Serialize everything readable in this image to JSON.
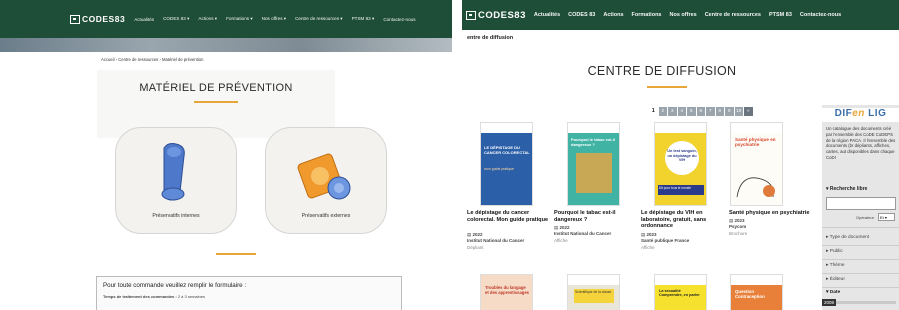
{
  "left": {
    "nav": {
      "logo": "CODES83",
      "items": [
        "Actualités",
        "CODES 83 ▾",
        "Actions ▾",
        "Formations ▾",
        "Nos offres ▾",
        "Centre de ressources ▾",
        "PTSM 83 ▾",
        "Contactez-nous"
      ]
    },
    "breadcrumb": "Accueil › Centre de ressources › Matériel de prévention",
    "title": "MATÉRIEL DE PRÉVENTION",
    "cards": [
      "Préservatifs internes",
      "Préservatifs externes"
    ],
    "form": {
      "title": "Pour toute commande veuillez remplir le formulaire :",
      "label": "Temps de traitement des commandes :",
      "value": " 2 à 3 semaines"
    }
  },
  "right": {
    "nav": {
      "logo": "CODES83",
      "items": [
        "Actualités",
        "CODES 83",
        "Actions",
        "Formations",
        "Nos offres",
        "Centre de ressources",
        "PTSM 83",
        "Contactez-nous"
      ]
    },
    "subheading": "entre de diffusion",
    "title": "CENTRE DE DIFFUSION",
    "pager": {
      "current": "1",
      "pages": [
        "2",
        "3",
        "4",
        "5",
        "6",
        "7",
        "8",
        "9",
        "10"
      ],
      "next": "»"
    },
    "books": [
      {
        "title": "Le dépistage du cancer colorectal. Mon guide pratique",
        "year": "2022",
        "publisher": "Institut National du Cancer",
        "type": "Dépliant"
      },
      {
        "title": "Pourquoi le tabac est-il dangereux ?",
        "year": "2022",
        "publisher": "Institut National du Cancer",
        "type": "Affiche"
      },
      {
        "title": "Le dépistage du VIH en laboratoire, gratuit, sans ordonnance",
        "year": "2023",
        "publisher": "Santé publique France",
        "type": "Affiche"
      },
      {
        "title": "Santé physique en psychiatrie",
        "year": "2023",
        "publisher": "Psycom",
        "type": "Brochure"
      }
    ],
    "covers": [
      {
        "bg": "#2b5fa8",
        "text": "LE DÉPISTAGE DU CANCER COLORECTAL",
        "text2": "mon guide pratique"
      },
      {
        "bg": "#41b3a5",
        "text": "Pourquoi le tabac est-il dangereux ?",
        "text2": ""
      },
      {
        "bg": "#f2d22c",
        "text": "Un test sanguin, un dépistage du VIH",
        "text2": "Dit pour tous le monde"
      },
      {
        "bg": "#fdfcf7",
        "text": "Santé physique en psychiatrie",
        "text2": ""
      }
    ],
    "bottom_covers": [
      {
        "bg": "#f6dcc7",
        "text": "Troubles du langage et des apprentissages"
      },
      {
        "bg": "#e9e5d8",
        "text": "Scientifique de la classe"
      },
      {
        "bg": "#f5e12e",
        "text": "La sexualité Comprendre, en parler"
      },
      {
        "bg": "#e8803a",
        "text": "Question Contraception"
      }
    ],
    "sidebar": {
      "logo_a": "DIF",
      "logo_b": "en",
      "logo_c": " LIG",
      "desc": "Un catalogue des documents créé par l'ensemble des CoDE CoDEPS de la région PACA. Il l'ensemble des documents (br dépliants, affiches, cartes, aut disponibles dans chaque CoDI",
      "search_label": "▾ Recherche libre",
      "operator_label": "Opérateur",
      "operator_value": "Et ▾",
      "facets": [
        "▸ Type de document",
        "▸ Public",
        "▸ Thème",
        "▸ Éditeur",
        "▾ Date"
      ],
      "year": "2008"
    }
  },
  "colors": {
    "nav": "#1e4d38",
    "accent": "#e7a63a"
  }
}
